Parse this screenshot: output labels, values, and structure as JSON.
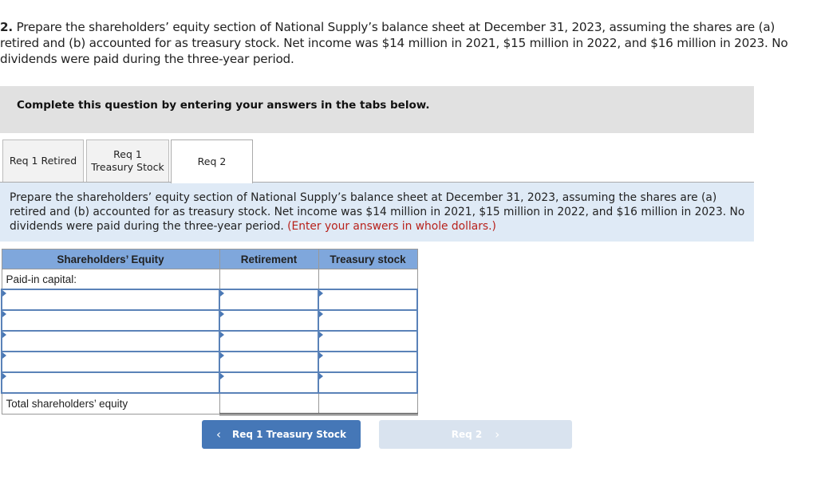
{
  "question": {
    "number": "2.",
    "text": "Prepare the shareholders’ equity section of National Supply’s balance sheet at December 31, 2023, assuming the shares are (a) retired and (b) accounted for as treasury stock. Net income was $14 million in 2021, $15 million in 2022, and $16 million in 2023. No dividends were paid during the three-year period."
  },
  "instruction": "Complete this question by entering your answers in the tabs below.",
  "tabs": [
    {
      "line1": "Req 1 Retired",
      "line2": ""
    },
    {
      "line1": "Req 1",
      "line2": "Treasury Stock"
    },
    {
      "line1": "Req 2",
      "line2": "",
      "active": true
    }
  ],
  "prompt": {
    "text": "Prepare the shareholders’ equity section of National Supply’s balance sheet at December 31, 2023, assuming the shares are (a) retired and (b) accounted for as treasury stock. Net income was $14 million in 2021, $15 million in 2022, and $16 million in 2023. No dividends were paid during the three-year period.",
    "note": "(Enter your answers in whole dollars.)"
  },
  "table": {
    "headers": [
      "Shareholders’ Equity",
      "Retirement",
      "Treasury stock"
    ],
    "section_label": "Paid-in capital:",
    "input_rows": [
      {
        "label": "",
        "retirement": "",
        "treasury": ""
      },
      {
        "label": "",
        "retirement": "",
        "treasury": ""
      },
      {
        "label": "",
        "retirement": "",
        "treasury": ""
      },
      {
        "label": "",
        "retirement": "",
        "treasury": ""
      },
      {
        "label": "",
        "retirement": "",
        "treasury": ""
      }
    ],
    "total_label": "Total shareholders’ equity",
    "total_retirement": "",
    "total_treasury": ""
  },
  "nav": {
    "prev_label": "Req 1 Treasury Stock",
    "next_label": "Req 2",
    "prev_icon": "‹",
    "next_icon": "›"
  },
  "colors": {
    "header_blue": "#7fa7dc",
    "prompt_bg": "#dfeaf6",
    "note_red": "#b8221c",
    "button_blue": "#4577b7",
    "button_disabled": "#d9e3ef"
  }
}
